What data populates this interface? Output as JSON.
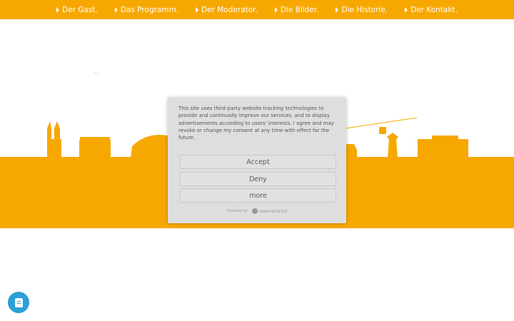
{
  "nav": {
    "items": [
      {
        "label": "Der Gast."
      },
      {
        "label": "Das Programm."
      },
      {
        "label": "Der Moderator."
      },
      {
        "label": "Die Bilder."
      },
      {
        "label": "Die Historie."
      },
      {
        "label": "Der Kontakt."
      }
    ]
  },
  "consent": {
    "text": "This site uses third-party website tracking technologies to provide and continually improve our services, and to display advertisements according to users' interests. I agree and may revoke or change my consent at any time with effect for the future.",
    "accept_label": "Accept",
    "deny_label": "Deny",
    "more_label": "more",
    "powered_by_label": "Powered by",
    "brand_label": "usercentrics"
  },
  "colors": {
    "brand_orange": "#f7a800",
    "chat_blue": "#2a9fd8"
  },
  "icons": {
    "chat": "chat-icon",
    "nav_bullet": "triangle-right-icon"
  }
}
